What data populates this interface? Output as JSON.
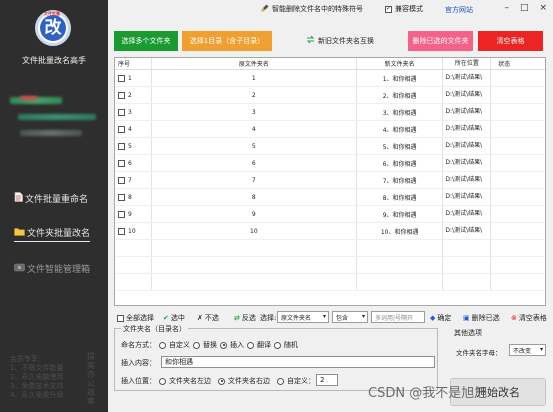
{
  "sidebar": {
    "logo_text": "改",
    "logo_tag": "文件批量",
    "app_title": "文件批量改名高手",
    "nav": [
      {
        "label": "文件批量重命名",
        "icon": "file-icon"
      },
      {
        "label": "文件夹批量改名",
        "icon": "folder-icon"
      },
      {
        "label": "文件智能管理箱",
        "icon": "manage-icon"
      }
    ],
    "promo": [
      "会员专享：",
      "1、不限文件数量",
      "2、永久电脑使用",
      "3、免费技术支持",
      "4、永久免费升级"
    ],
    "promo_side": "提高办公效率"
  },
  "topbar": {
    "strip_label": "智能删除文件名中的特殊符号",
    "mode_label": "兼容模式",
    "official_site": "官方网站",
    "window_controls": [
      "–",
      "□",
      "×"
    ]
  },
  "actions": {
    "select_folders": "选择多个文件夹",
    "select_dir": "选择1目录（含子目录）",
    "swap_names": "新旧文件夹名互换",
    "delete_selected": "删除已选的文件夹",
    "clear_table": "清空表格"
  },
  "table": {
    "headers": [
      "序号",
      "原文件夹名",
      "新文件夹名",
      "所在位置",
      "状态"
    ],
    "rows": [
      {
        "seq": "1",
        "old": "1",
        "new": "1、和你相遇",
        "loc": "D:\\测试\\结果\\",
        "status": ""
      },
      {
        "seq": "2",
        "old": "2",
        "new": "2、和你相遇",
        "loc": "D:\\测试\\结果\\",
        "status": ""
      },
      {
        "seq": "3",
        "old": "3",
        "new": "3、和你相遇",
        "loc": "D:\\测试\\结果\\",
        "status": ""
      },
      {
        "seq": "4",
        "old": "4",
        "new": "4、和你相遇",
        "loc": "D:\\测试\\结果\\",
        "status": ""
      },
      {
        "seq": "5",
        "old": "5",
        "new": "5、和你相遇",
        "loc": "D:\\测试\\结果\\",
        "status": ""
      },
      {
        "seq": "6",
        "old": "6",
        "new": "6、和你相遇",
        "loc": "D:\\测试\\结果\\",
        "status": ""
      },
      {
        "seq": "7",
        "old": "7",
        "new": "7、和你相遇",
        "loc": "D:\\测试\\结果\\",
        "status": ""
      },
      {
        "seq": "8",
        "old": "8",
        "new": "8、和你相遇",
        "loc": "D:\\测试\\结果\\",
        "status": ""
      },
      {
        "seq": "9",
        "old": "9",
        "new": "9、和你相遇",
        "loc": "D:\\测试\\结果\\",
        "status": ""
      },
      {
        "seq": "10",
        "old": "10",
        "new": "10、和你相遇",
        "loc": "D:\\测试\\结果\\",
        "status": ""
      }
    ]
  },
  "select_bar": {
    "select_all": "全部选择",
    "check": "选中",
    "uncheck": "不选",
    "invert": "反选",
    "choose_label": "选择:",
    "choose_field": "原文件夹名",
    "match_mode": "包含",
    "filter_placeholder": "多词用|号隔开",
    "confirm": "确定",
    "delete_checked": "删除已选",
    "clear_table": "清空表格"
  },
  "name_panel": {
    "title": "文件夹名（目录名）",
    "mode_label": "命名方式：",
    "modes": [
      "自定义",
      "替换",
      "插入",
      "翻译",
      "随机"
    ],
    "selected_mode": "插入",
    "insert_label": "插入内容：",
    "insert_value": "和你相遇",
    "position_label": "插入位置：",
    "positions": [
      "文件夹名左边",
      "文件夹名右边",
      "自定义："
    ],
    "custom_position": "2"
  },
  "other_options": {
    "title": "其他选项",
    "case_label": "文件夹名字母：",
    "case_value": "不改变"
  },
  "start_button": "开始改名",
  "watermark": "CSDN @我不是旭旭"
}
